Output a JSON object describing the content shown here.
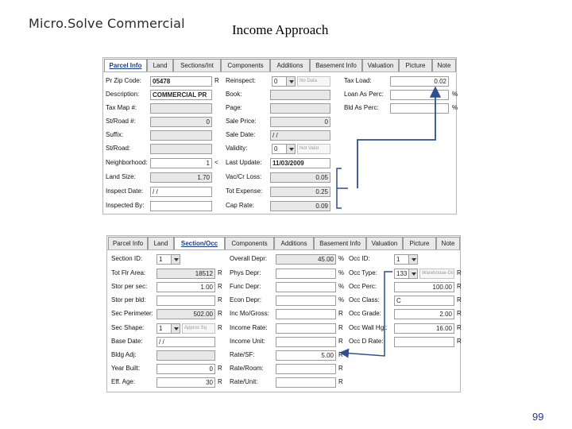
{
  "slide": {
    "title": "Micro.Solve Commercial",
    "heading": "Income Approach",
    "page_number": "99"
  },
  "colors": {
    "arrow": "#2f4f8f",
    "active_tab": "#1a3e8a"
  },
  "panel1": {
    "tabs": [
      "Parcel Info",
      "Land",
      "Sections/Int",
      "Components",
      "Additions",
      "Basement Info",
      "Valuation",
      "Picture",
      "Note"
    ],
    "active_tab": "Parcel Info",
    "left": {
      "labels": [
        "Pr Zip Code:",
        "Description:",
        "Tax Map #:",
        "St/Road #:",
        "Suffix:",
        "St/Road:",
        "Neighborhood:",
        "Land Size:",
        "Inspect Date:",
        "Inspected By:"
      ],
      "values": [
        "05478",
        "COMMERCIAL PR",
        "",
        "0",
        "",
        "",
        "1",
        "1.70",
        "/ /",
        ""
      ],
      "suffixes": [
        "R",
        "",
        "",
        "",
        "",
        "",
        "<",
        "",
        "",
        ""
      ]
    },
    "mid": {
      "labels": [
        "Reinspect:",
        "Book:",
        "Page:",
        "Sale Price:",
        "Sale Date:",
        "Validity:",
        "Last Update:",
        "Vac/Cr Loss:",
        "Tot Expense:",
        "Cap Rate:"
      ],
      "reinspect_value": "0",
      "reinspect_hint": "No Data",
      "sale_price": "0",
      "sale_date": "/ /",
      "validity_value": "0",
      "validity_hint": "Not Valid",
      "last_update": "11/03/2009",
      "vac_cr_loss": "0.05",
      "tot_expense": "0.25",
      "cap_rate": "0.09"
    },
    "right": {
      "labels": [
        "Tax Load:",
        "Loan As Perc:",
        "Bld As Perc:"
      ],
      "values": [
        "0.02",
        "",
        ""
      ],
      "suffixes": [
        "",
        "%",
        "%"
      ]
    }
  },
  "panel2": {
    "tabs": [
      "Parcel Info",
      "Land",
      "Section/Occ",
      "Components",
      "Additions",
      "Basement Info",
      "Valuation",
      "Picture",
      "Note"
    ],
    "active_tab": "Section/Occ",
    "left": {
      "labels": [
        "Section ID:",
        "Tot Flr Area:",
        "Stor per sec:",
        "Stor per bld:",
        "Sec Perimeter:",
        "Sec Shape:",
        "Base Date:",
        "Bldg Adj:",
        "Year Built:",
        "Eff. Age:"
      ],
      "section_id": "1",
      "tot_flr_area": "18512",
      "stor_per_sec": "1.00",
      "stor_per_bld": "",
      "sec_perimeter": "502.00",
      "sec_shape_value": "1",
      "sec_shape_hint": "Approx Sq",
      "base_date": "/ /",
      "bldg_adj": "",
      "year_built": "0",
      "eff_age": "30",
      "suffixes": [
        "",
        "R",
        "R",
        "R",
        "R",
        "R",
        "",
        "",
        "R",
        "R"
      ]
    },
    "mid": {
      "labels": [
        "Overall Depr:",
        "Phys Depr:",
        "Func Depr:",
        "Econ Depr:",
        "Inc Mo/Gross:",
        "Income Rate:",
        "Income Unit:",
        "Rate/SF:",
        "Rate/Room:",
        "Rate/Unit:"
      ],
      "values": [
        "45.00",
        "",
        "",
        "",
        "",
        "",
        "",
        "5.00",
        "",
        ""
      ],
      "suffixes": [
        "%",
        "%",
        "%",
        "%",
        "R",
        "R",
        "R",
        "R",
        "R",
        "R"
      ]
    },
    "right": {
      "labels": [
        "Occ ID:",
        "Occ Type:",
        "Occ Perc:",
        "Occ Class:",
        "Occ Grade:",
        "Occ Wall Hgt:",
        "Occ D Rate:"
      ],
      "occ_id": "1",
      "occ_type_value": "133",
      "occ_type_hint": "Warehouse-Dist",
      "occ_perc": "100.00",
      "occ_class": "C",
      "occ_grade": "2.00",
      "occ_wall_hgt": "16.00",
      "occ_d_rate": "",
      "suffixes": [
        "",
        "R",
        "R",
        "R",
        "R",
        "R",
        "R"
      ]
    }
  }
}
